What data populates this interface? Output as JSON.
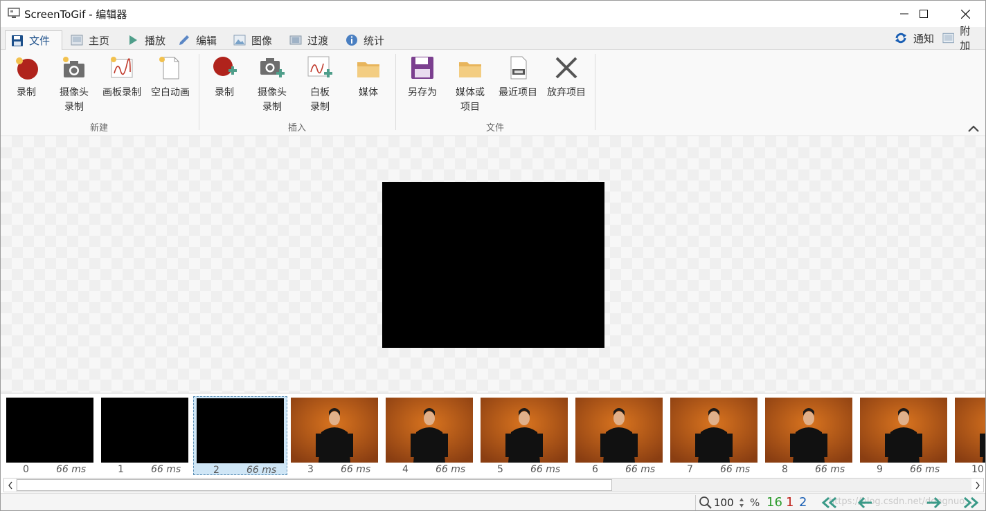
{
  "window": {
    "title": "ScreenToGif - 编辑器"
  },
  "tabs": [
    {
      "label": "文件",
      "icon": "floppy-icon",
      "active": true
    },
    {
      "label": "主页",
      "icon": "image-icon"
    },
    {
      "label": "播放",
      "icon": "play-icon"
    },
    {
      "label": "编辑",
      "icon": "pencil-icon"
    },
    {
      "label": "图像",
      "icon": "picture-icon"
    },
    {
      "label": "过渡",
      "icon": "transition-icon"
    },
    {
      "label": "统计",
      "icon": "info-icon"
    }
  ],
  "right_tabs": [
    {
      "label": "通知",
      "icon": "refresh-icon"
    },
    {
      "label": "附加",
      "icon": "extras-icon"
    }
  ],
  "ribbon": {
    "groups": {
      "new": {
        "label": "新建",
        "buttons": [
          "录制",
          "摄像头\n录制",
          "画板录制",
          "空白动画"
        ]
      },
      "insert": {
        "label": "插入",
        "buttons": [
          "录制",
          "摄像头\n录制",
          "白板\n录制",
          "媒体"
        ]
      },
      "file": {
        "label": "文件",
        "buttons": [
          "另存为",
          "媒体或\n项目",
          "最近项目",
          "放弃项目"
        ]
      }
    }
  },
  "frames": [
    {
      "index": "0",
      "duration": "66 ms",
      "type": "black"
    },
    {
      "index": "1",
      "duration": "66 ms",
      "type": "black"
    },
    {
      "index": "2",
      "duration": "66 ms",
      "type": "black",
      "selected": true
    },
    {
      "index": "3",
      "duration": "66 ms",
      "type": "person"
    },
    {
      "index": "4",
      "duration": "66 ms",
      "type": "person"
    },
    {
      "index": "5",
      "duration": "66 ms",
      "type": "person"
    },
    {
      "index": "6",
      "duration": "66 ms",
      "type": "person"
    },
    {
      "index": "7",
      "duration": "66 ms",
      "type": "person"
    },
    {
      "index": "8",
      "duration": "66 ms",
      "type": "person"
    },
    {
      "index": "9",
      "duration": "66 ms",
      "type": "person"
    },
    {
      "index": "10",
      "duration": "",
      "type": "person"
    }
  ],
  "status": {
    "zoom": "100",
    "zoom_unit": "%",
    "total_frames": "16",
    "selected_count": "1",
    "current_frame": "2",
    "watermark": "https://blog.csdn.net/dongnuo..."
  },
  "colors": {
    "accent": "#1c4f8a",
    "record_red": "#b0231c",
    "save_purple": "#7b3f8f",
    "green_count": "#2a9a2a",
    "red_count": "#c0221c",
    "blue_count": "#1a5fb4",
    "nav_green": "#3a9a88"
  }
}
